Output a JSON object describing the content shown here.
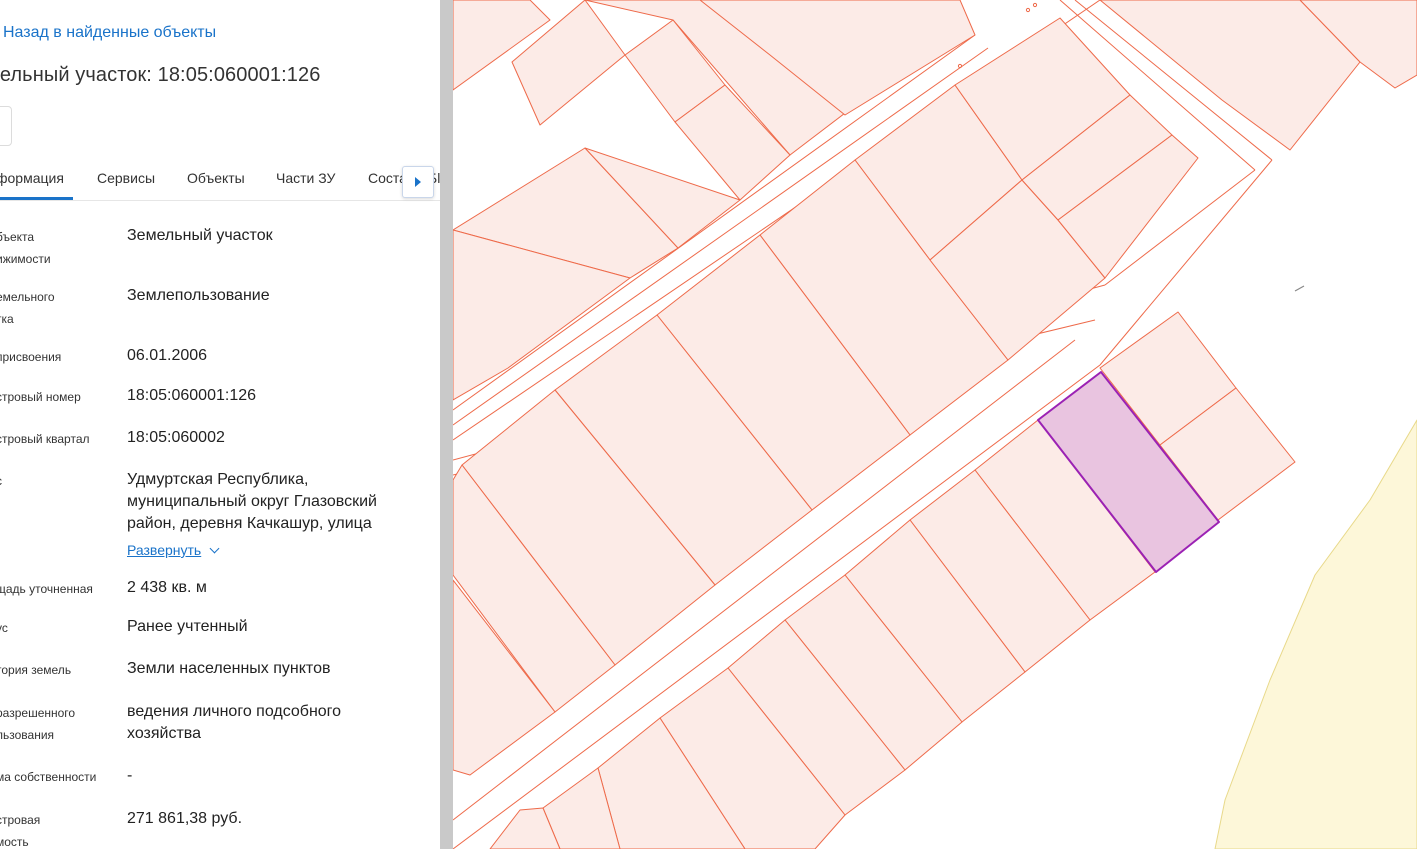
{
  "panel": {
    "back_link": "Назад в найденные объекты",
    "title": "мельный участок: 18:05:060001:126",
    "tabs": [
      {
        "label": "формация",
        "active": true
      },
      {
        "label": "Сервисы"
      },
      {
        "label": "Объекты"
      },
      {
        "label": "Части ЗУ"
      },
      {
        "label": "Соста"
      }
    ],
    "tab_tail": "Бl",
    "rows": [
      {
        "label": "бъекта\nижимости",
        "value": "Земельный участок"
      },
      {
        "label": "емельного\nтка",
        "value": "Землепользование"
      },
      {
        "label": "присвоения",
        "value": "06.01.2006"
      },
      {
        "label": "стровый номер",
        "value": "18:05:060001:126"
      },
      {
        "label": "стровый квартал",
        "value": "18:05:060002"
      },
      {
        "label": "с",
        "value": "Удмуртская Республика,\nмуниципальный округ Глазовский\nрайон, деревня Качкашур, улица"
      },
      {
        "label": "щадь уточненная",
        "value": "2 438 кв. м"
      },
      {
        "label": "ус",
        "value": "Ранее учтенный"
      },
      {
        "label": "тория земель",
        "value": "Земли населенных пунктов"
      },
      {
        "label": "разрешенного\nльзования",
        "value": "ведения личного подсобного\nхозяйства"
      },
      {
        "label": "ма собственности",
        "value": "-"
      },
      {
        "label": "стровая\nмость",
        "value": "271 861,38 руб."
      }
    ],
    "expand_label": "Развернуть"
  },
  "map": {
    "parcel_fill": "#fcebe7",
    "parcel_stroke": "#ee6a4a",
    "selected_fill": "#e9c4e0",
    "selected_stroke": "#9b22b4",
    "zone_fill": "#fdf7d9"
  }
}
